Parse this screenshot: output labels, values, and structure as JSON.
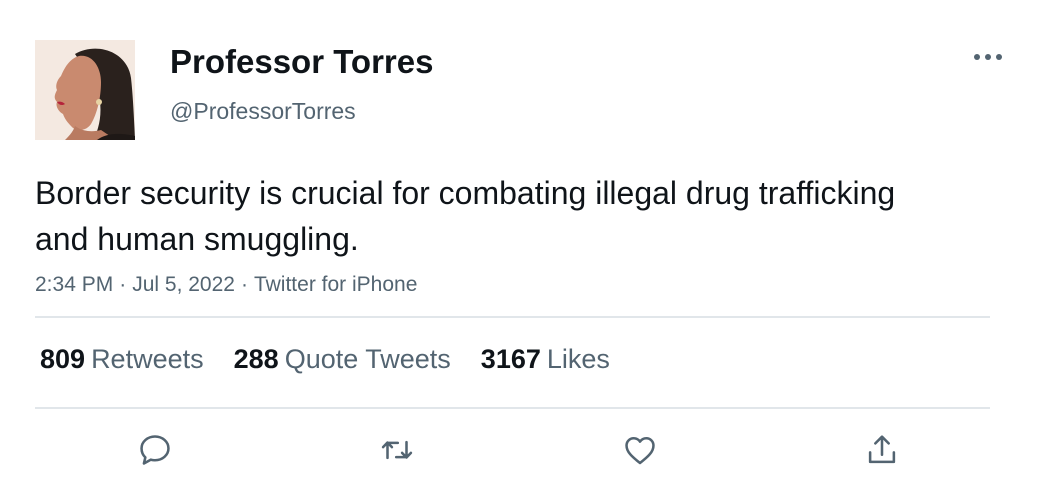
{
  "author": {
    "display_name": "Professor Torres",
    "handle": "@ProfessorTorres",
    "avatar_icon": "profile-photo"
  },
  "tweet": {
    "text": "Border security is crucial for combating illegal drug trafficking and human smuggling.",
    "time": "2:34 PM",
    "date": "Jul 5, 2022",
    "source": "Twitter for iPhone",
    "separator": "·"
  },
  "stats": {
    "retweets": {
      "count": "809",
      "label": "Retweets"
    },
    "quotes": {
      "count": "288",
      "label": "Quote Tweets"
    },
    "likes": {
      "count": "3167",
      "label": "Likes"
    }
  },
  "actions": {
    "reply_icon": "reply-icon",
    "retweet_icon": "retweet-icon",
    "like_icon": "heart-icon",
    "share_icon": "share-icon",
    "more_icon": "more-options-icon"
  },
  "colors": {
    "text_primary": "#0f1419",
    "text_secondary": "#536471",
    "divider": "#e1e6ea",
    "icon": "#536471"
  }
}
